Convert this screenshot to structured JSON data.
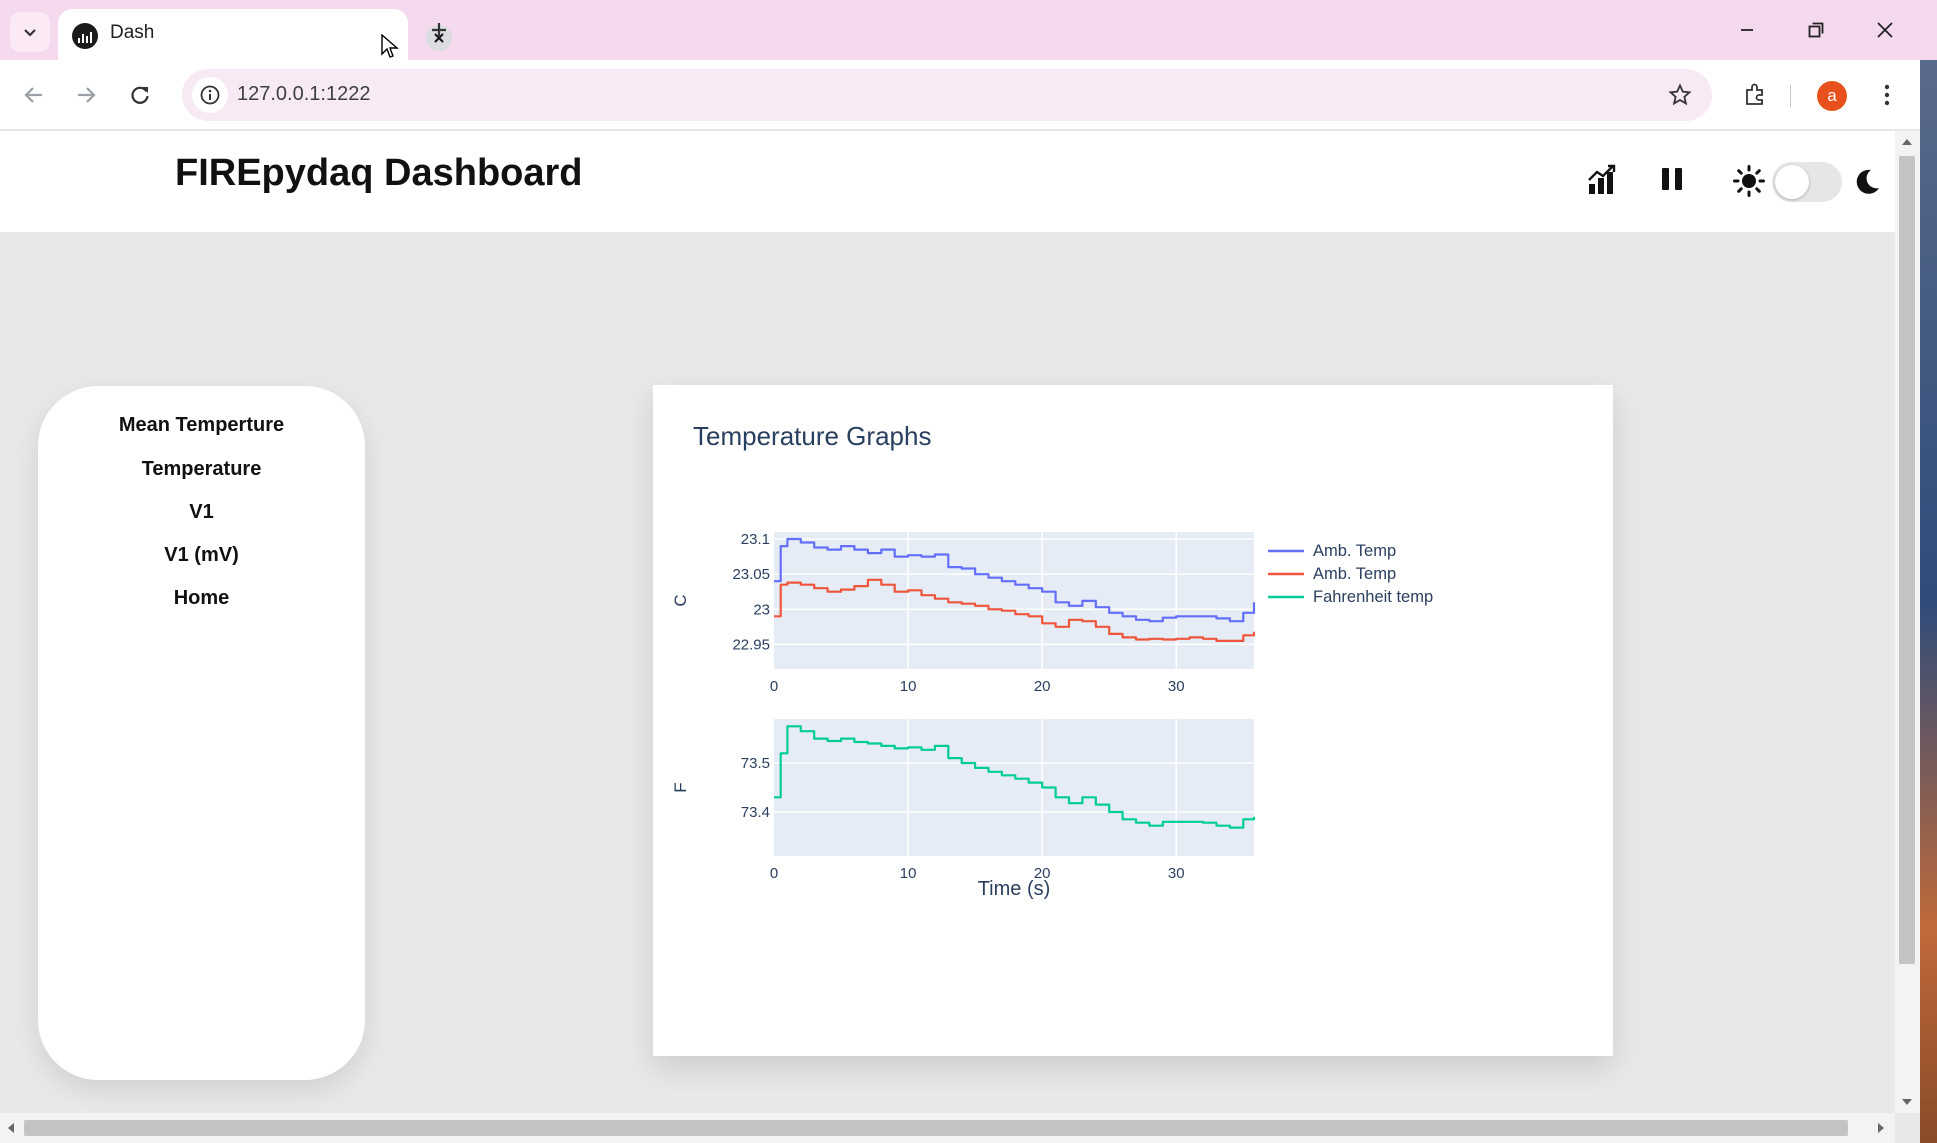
{
  "browser": {
    "tab_title": "Dash",
    "url": "127.0.0.1:1222",
    "profile_initial": "a",
    "icons": [
      "tab-list-icon",
      "dash-favicon-icon",
      "close-icon",
      "plus-icon",
      "minimize-icon",
      "restore-icon",
      "window-close-icon",
      "back-arrow-icon",
      "forward-arrow-icon",
      "reload-icon",
      "info-icon",
      "star-icon",
      "extensions-icon",
      "kebab-menu-icon"
    ]
  },
  "page": {
    "title": "FIREpydaq Dashboard",
    "header_icons": [
      "bar-chart-icon",
      "pause-icon",
      "sun-icon",
      "moon-icon"
    ],
    "theme_toggle_on": false
  },
  "sidebar": {
    "items": [
      {
        "label": "Mean Temperture"
      },
      {
        "label": "Temperature"
      },
      {
        "label": "V1"
      },
      {
        "label": "V1 (mV)"
      },
      {
        "label": "Home"
      }
    ]
  },
  "chart_data": {
    "type": "line",
    "title": "Temperature Graphs",
    "xlabel": "Time (s)",
    "legend_position": "right",
    "subplots": [
      {
        "ylabel": "C",
        "xlim": [
          0,
          35.8
        ],
        "ylim": [
          22.915,
          23.11
        ],
        "x_ticks": [
          0,
          10,
          20,
          30
        ],
        "y_ticks": [
          22.95,
          23,
          23.05,
          23.1
        ],
        "y_tick_labels": [
          "22.95",
          "23",
          "23.05",
          "23.1"
        ],
        "series": [
          {
            "name": "Amb. Temp",
            "color": "#636efa",
            "x": [
              0,
              0.5,
              1,
              2,
              3,
              4,
              5,
              6,
              7,
              8,
              9,
              10,
              11,
              12,
              13,
              14,
              15,
              16,
              17,
              18,
              19,
              20,
              21,
              22,
              23,
              24,
              25,
              26,
              27,
              28,
              29,
              30,
              31,
              32,
              33,
              34,
              35,
              35.8
            ],
            "y": [
              23.04,
              23.09,
              23.1,
              23.095,
              23.088,
              23.085,
              23.09,
              23.085,
              23.08,
              23.085,
              23.075,
              23.077,
              23.075,
              23.078,
              23.06,
              23.058,
              23.05,
              23.045,
              23.04,
              23.035,
              23.03,
              23.025,
              23.01,
              23.005,
              23.012,
              23.003,
              22.995,
              22.99,
              22.985,
              22.983,
              22.988,
              22.99,
              22.99,
              22.99,
              22.987,
              22.983,
              22.995,
              23.01
            ]
          },
          {
            "name": "Amb. Temp",
            "color": "#ef553b",
            "x": [
              0,
              0.5,
              1,
              2,
              3,
              4,
              5,
              6,
              7,
              8,
              9,
              10,
              11,
              12,
              13,
              14,
              15,
              16,
              17,
              18,
              19,
              20,
              21,
              22,
              23,
              24,
              25,
              26,
              27,
              28,
              29,
              30,
              31,
              32,
              33,
              34,
              35,
              35.8
            ],
            "y": [
              22.99,
              23.035,
              23.038,
              23.035,
              23.03,
              23.025,
              23.028,
              23.033,
              23.042,
              23.035,
              23.025,
              23.027,
              23.02,
              23.015,
              23.01,
              23.008,
              23.005,
              23.0,
              22.998,
              22.993,
              22.99,
              22.98,
              22.975,
              22.985,
              22.983,
              22.975,
              22.965,
              22.96,
              22.957,
              22.958,
              22.957,
              22.958,
              22.96,
              22.958,
              22.955,
              22.955,
              22.963,
              22.968
            ]
          }
        ]
      },
      {
        "ylabel": "F",
        "xlim": [
          0,
          35.8
        ],
        "ylim": [
          73.31,
          73.59
        ],
        "x_ticks": [
          0,
          10,
          20,
          30
        ],
        "y_ticks": [
          73.4,
          73.5
        ],
        "y_tick_labels": [
          "73.4",
          "73.5"
        ],
        "series": [
          {
            "name": "Fahrenheit temp",
            "color": "#00cc96",
            "x": [
              0,
              0.5,
              1,
              2,
              3,
              4,
              5,
              6,
              7,
              8,
              9,
              10,
              11,
              12,
              13,
              14,
              15,
              16,
              17,
              18,
              19,
              20,
              21,
              22,
              23,
              24,
              25,
              26,
              27,
              28,
              29,
              30,
              31,
              32,
              33,
              34,
              35,
              35.8
            ],
            "y": [
              73.43,
              73.52,
              73.575,
              73.565,
              73.55,
              73.545,
              73.55,
              73.543,
              73.54,
              73.535,
              73.53,
              73.532,
              73.527,
              73.535,
              73.51,
              73.5,
              73.49,
              73.482,
              73.475,
              73.468,
              73.46,
              73.45,
              73.43,
              73.418,
              73.43,
              73.415,
              73.4,
              73.385,
              73.378,
              73.372,
              73.38,
              73.38,
              73.38,
              73.378,
              73.372,
              73.368,
              73.385,
              73.39
            ]
          }
        ]
      }
    ]
  }
}
